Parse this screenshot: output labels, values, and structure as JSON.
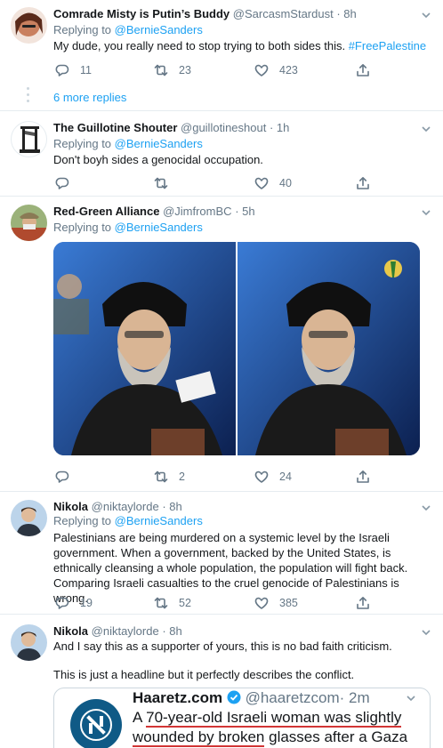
{
  "tweets": [
    {
      "name": "Comrade Misty is Putin’s Buddy",
      "handle": "@SarcasmStardust",
      "time": "· 8h",
      "reply_prefix": "Replying to ",
      "reply_to": "@BernieSanders",
      "text": "My dude, you really need to stop trying to both sides this. ",
      "hashtag": "#FreePalestine",
      "replies": "11",
      "retweets": "23",
      "likes": "423"
    },
    {
      "more_replies": "6 more replies"
    },
    {
      "name": "The Guillotine Shouter",
      "handle": "@guillotineshout",
      "time": "· 1h",
      "reply_prefix": "Replying to ",
      "reply_to": "@BernieSanders",
      "text": "Don't boyh sides a genocidal occupation.",
      "likes": "40"
    },
    {
      "name": "Red-Green Alliance",
      "handle": "@JimfromBC",
      "time": "· 5h",
      "reply_prefix": "Replying to ",
      "reply_to": "@BernieSanders",
      "retweets": "2",
      "likes": "24"
    },
    {
      "name": "Nikola",
      "handle": "@niktaylorde",
      "time": "· 8h",
      "reply_prefix": "Replying to ",
      "reply_to": "@BernieSanders",
      "text": "Palestinians are being murdered on a systemic level by the Israeli government. When a government, backed by the United States, is ethnically cleansing a whole population, the population will fight back. Comparing Israeli casualties to the cruel genocide of Palestinians is wrong.",
      "replies": "19",
      "retweets": "52",
      "likes": "385"
    },
    {
      "name": "Nikola",
      "handle": "@niktaylorde",
      "time": "· 8h",
      "text": "And I say this as a supporter of yours, this is no bad faith criticism.",
      "text2": "This is just a headline but it perfectly describes the conflict.",
      "quote": {
        "name": "Haaretz.com",
        "handle": "@haaretzcom",
        "time": "· 2m",
        "text_a": "A ",
        "text_b": "70-year-old Israeli woman was slightly wounded by broken",
        "text_c": " glasses after a Gaza"
      }
    }
  ],
  "colors": {
    "link": "#1da1f2",
    "muted": "#657786",
    "text": "#14171a",
    "divider": "#e6ecf0",
    "verified": "#1da1f2",
    "underline": "#d23535"
  },
  "icons": [
    "reply-icon",
    "retweet-icon",
    "like-icon",
    "share-icon",
    "caret-down-icon",
    "verified-icon"
  ]
}
